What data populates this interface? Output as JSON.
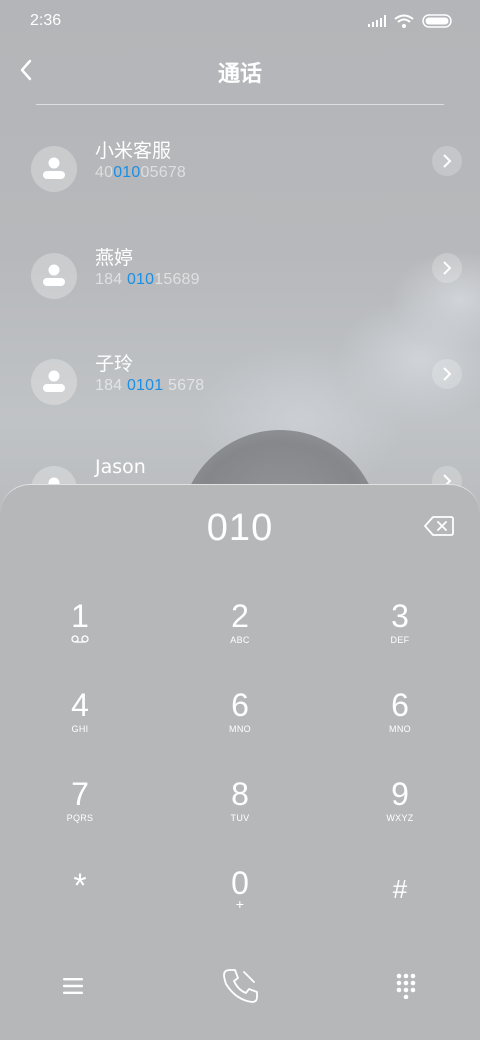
{
  "status": {
    "time": "2:36"
  },
  "header": {
    "title": "通话"
  },
  "contacts": [
    {
      "name": "小米客服",
      "num_pre": "40",
      "num_hl": "010",
      "num_post": "05678"
    },
    {
      "name": "燕婷",
      "num_pre": "184 ",
      "num_hl": "010",
      "num_post": "15689"
    },
    {
      "name": "子玲",
      "num_pre": "184 ",
      "num_hl": "0101",
      "num_post": " 5678"
    },
    {
      "name": "Jason",
      "num_pre": "",
      "num_hl": "",
      "num_post": ""
    }
  ],
  "dialer": {
    "input": "010",
    "keys": [
      {
        "digit": "1",
        "letters": ""
      },
      {
        "digit": "2",
        "letters": "ABC"
      },
      {
        "digit": "3",
        "letters": "DEF"
      },
      {
        "digit": "4",
        "letters": "GHI"
      },
      {
        "digit": "6",
        "letters": "MNO"
      },
      {
        "digit": "6",
        "letters": "MNO"
      },
      {
        "digit": "7",
        "letters": "PQRS"
      },
      {
        "digit": "8",
        "letters": "TUV"
      },
      {
        "digit": "9",
        "letters": "WXYZ"
      },
      {
        "digit": "*",
        "letters": ""
      },
      {
        "digit": "0",
        "letters": "+"
      },
      {
        "digit": "#",
        "letters": ""
      }
    ]
  },
  "icons": {
    "voicemail": "voicemail-icon",
    "menu": "menu-icon",
    "call": "phone-call-icon",
    "keypad": "keypad-icon",
    "backspace": "backspace-icon",
    "back": "back-arrow-icon",
    "chevron": "chevron-right-icon"
  },
  "colors": {
    "highlight": "#1a8fe6"
  }
}
